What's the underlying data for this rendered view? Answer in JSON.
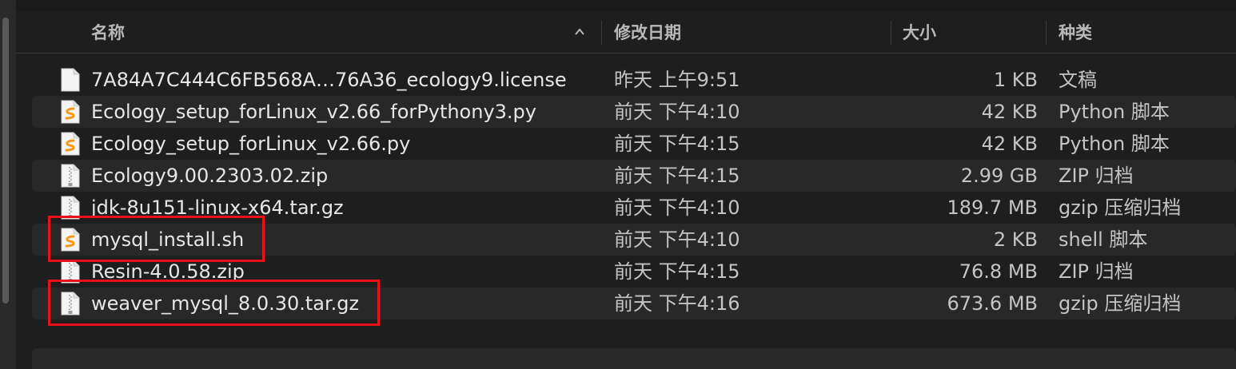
{
  "header": {
    "name_label": "名称",
    "date_label": "修改日期",
    "size_label": "大小",
    "kind_label": "种类"
  },
  "files": [
    {
      "name": "7A84A7C444C6FB568A…76A36_ecology9.license",
      "date": "昨天 上午9:51",
      "size": "1 KB",
      "kind": "文稿",
      "icon": "document-icon",
      "highlighted": false
    },
    {
      "name": "Ecology_setup_forLinux_v2.66_forPythony3.py",
      "date": "前天 下午4:10",
      "size": "42 KB",
      "kind": "Python 脚本",
      "icon": "script-file-icon",
      "highlighted": false
    },
    {
      "name": "Ecology_setup_forLinux_v2.66.py",
      "date": "前天 下午4:15",
      "size": "42 KB",
      "kind": "Python 脚本",
      "icon": "script-file-icon",
      "highlighted": false
    },
    {
      "name": "Ecology9.00.2303.02.zip",
      "date": "前天 下午4:15",
      "size": "2.99 GB",
      "kind": "ZIP 归档",
      "icon": "archive-file-icon",
      "highlighted": false
    },
    {
      "name": "jdk-8u151-linux-x64.tar.gz",
      "date": "前天 下午4:10",
      "size": "189.7 MB",
      "kind": "gzip 压缩归档",
      "icon": "archive-file-icon",
      "highlighted": false
    },
    {
      "name": "mysql_install.sh",
      "date": "前天 下午4:10",
      "size": "2 KB",
      "kind": "shell 脚本",
      "icon": "script-file-icon",
      "highlighted": true
    },
    {
      "name": "Resin-4.0.58.zip",
      "date": "前天 下午4:15",
      "size": "76.8 MB",
      "kind": "ZIP 归档",
      "icon": "archive-file-icon",
      "highlighted": false
    },
    {
      "name": "weaver_mysql_8.0.30.tar.gz",
      "date": "前天 下午4:16",
      "size": "673.6 MB",
      "kind": "gzip 压缩归档",
      "icon": "archive-file-icon",
      "highlighted": true
    }
  ],
  "colors": {
    "highlight_border": "#e8101a",
    "script_icon_accent": "#f39a1e"
  }
}
